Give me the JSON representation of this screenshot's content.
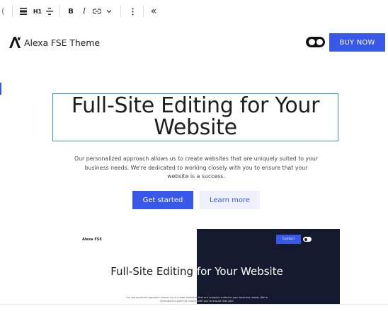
{
  "toolbar": {
    "items": [
      {
        "name": "drag-handle-icon",
        "glyph": "⋮⋮"
      },
      {
        "name": "align-icon",
        "glyph": "≡"
      },
      {
        "name": "heading-level",
        "label": "H1"
      },
      {
        "name": "text-align-icon",
        "glyph": "≑"
      },
      {
        "name": "bold-button",
        "label": "B"
      },
      {
        "name": "italic-button",
        "label": "I"
      },
      {
        "name": "link-icon",
        "glyph": "⊖"
      },
      {
        "name": "more-rich-text-icon",
        "glyph": "⌄"
      },
      {
        "name": "options-icon",
        "glyph": "⋮"
      },
      {
        "name": "collapse-toolbar-icon",
        "glyph": "«"
      }
    ]
  },
  "header": {
    "logo_text": "A'",
    "site_title": "Alexa FSE Theme",
    "buy_label": "BUY NOW"
  },
  "hero": {
    "title": "Full-Site Editing for Your Website",
    "description": "Our personalized approach allows us to create websites that are uniquely suited to your business needs. We're dedicated to working closely with you to ensure that your website is a success.",
    "primary_label": "Get started",
    "secondary_label": "Learn more"
  },
  "preview": {
    "brand": "Alexa FSE",
    "contact_label": "Contact",
    "title": "Full-Site Editing for Your Website",
    "description": "Our personalized approach allows us to create websites that are uniquely suited to your business needs. We're dedicated to working closely with you to ensure that your"
  },
  "colors": {
    "accent": "#3858e9",
    "selection_border": "#3d91b4",
    "dark_panel": "#151a2e"
  }
}
